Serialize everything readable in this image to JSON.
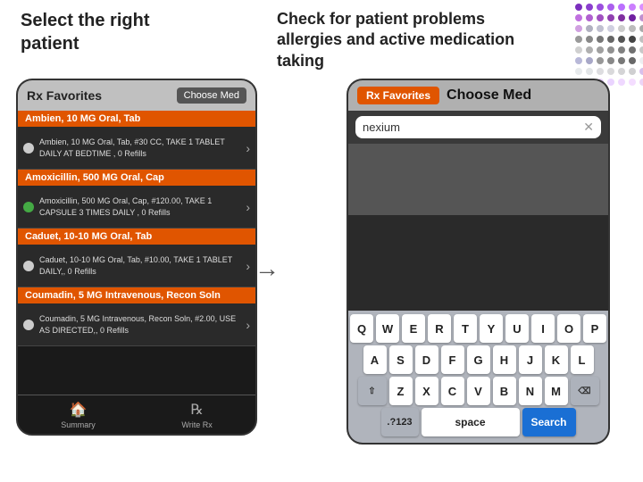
{
  "header": {
    "left_title": "Select the right patient",
    "center_title": "Check for patient problems allergies and active medication taking"
  },
  "dot_grid": {
    "colors": [
      "#6a1ab5",
      "#7a2ac5",
      "#8a3ad0",
      "#9a4ad0",
      "#aa5ad0",
      "#ba6ad0",
      "#ca7ad0",
      "#c080d0",
      "#b090c0",
      "#a0a0b0",
      "#9090a0",
      "#808090",
      "#707080",
      "#c0c0c0",
      "#d0d0d0",
      "#e0e0e0"
    ]
  },
  "left_phone": {
    "header": {
      "title": "Rx Favorites",
      "button": "Choose Med"
    },
    "sections": [
      {
        "header": "Ambien, 10 MG Oral, Tab",
        "item": {
          "dot_color": "#cccccc",
          "text": "Ambien, 10 MG Oral, Tab, #30 CC, TAKE 1 TABLET DAILY AT BEDTIME , 0 Refills"
        }
      },
      {
        "header": "Amoxicillin, 500 MG Oral, Cap",
        "item": {
          "dot_color": "#44aa44",
          "text": "Amoxicillin, 500 MG Oral, Cap, #120.00, TAKE 1 CAPSULE 3 TIMES DAILY , 0 Refills"
        }
      },
      {
        "header": "Caduet, 10-10 MG Oral, Tab",
        "item": {
          "dot_color": "#cccccc",
          "text": "Caduet, 10-10 MG Oral, Tab, #10.00, TAKE 1 TABLET DAILY,, 0 Refills"
        }
      },
      {
        "header": "Coumadin, 5 MG Intravenous, Recon Soln",
        "item": {
          "dot_color": "#cccccc",
          "text": "Coumadin, 5 MG Intravenous, Recon Soln, #2.00, USE AS DIRECTED,, 0 Refills"
        }
      }
    ],
    "bottom_nav": [
      {
        "label": "Summary",
        "icon": "🏠"
      },
      {
        "label": "Write Rx",
        "icon": "℞"
      }
    ]
  },
  "right_phone": {
    "header": {
      "tab": "Rx Favorites",
      "title": "Choose Med"
    },
    "search": {
      "value": "nexium",
      "clear_label": "✕"
    },
    "keyboard": {
      "rows": [
        [
          "Q",
          "W",
          "E",
          "R",
          "T",
          "Y",
          "U",
          "I",
          "O",
          "P"
        ],
        [
          "A",
          "S",
          "D",
          "F",
          "G",
          "H",
          "J",
          "K",
          "L"
        ],
        [
          "⇧",
          "Z",
          "X",
          "C",
          "V",
          "B",
          "N",
          "M",
          "⌫"
        ]
      ],
      "bottom_row": {
        "number_label": ".?123",
        "space_label": "space",
        "search_label": "Search"
      }
    }
  },
  "arrow": "→"
}
